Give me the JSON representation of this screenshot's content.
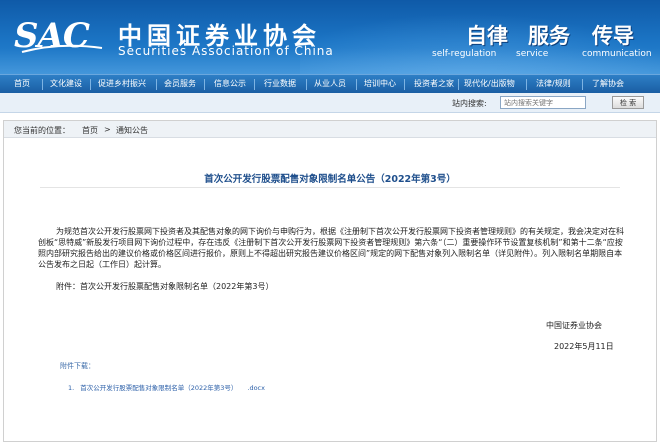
{
  "header": {
    "logo_text": "SAC",
    "org_name_cn": "中国证券业协会",
    "org_name_en": "Securities Association of China",
    "mottos": [
      {
        "cn": "自律",
        "en": "self-regulation"
      },
      {
        "cn": "服务",
        "en": "service"
      },
      {
        "cn": "传导",
        "en": "communication"
      }
    ]
  },
  "nav": {
    "items": [
      "首页",
      "文化建设",
      "促进乡村振兴",
      "会员服务",
      "信息公示",
      "行业数据",
      "从业人员",
      "培训中心",
      "投资者之家",
      "现代化/出版物",
      "法律/规则",
      "了解协会"
    ]
  },
  "search": {
    "label": "站内搜索:",
    "placeholder": "站内搜索关键字",
    "button": "检 索"
  },
  "breadcrumb": {
    "prefix": "您当前的位置：",
    "home": "首页",
    "sep": ">",
    "section": "通知公告"
  },
  "article": {
    "title": "首次公开发行股票配售对象限制名单公告（2022年第3号）",
    "body": "为规范首次公开发行股票网下投资者及其配售对象的网下询价与申购行为，根据《注册制下首次公开发行股票网下投资者管理规则》的有关规定，我会决定对在科创板“思特威”新股发行项目网下询价过程中，存在违反《注册制下首次公开发行股票网下投资者管理规则》第六条“（二）重要操作环节设置复核机制”和第十二条“应按照内部研究报告给出的建议价格或价格区间进行报价，原则上不得超出研究报告建议价格区间”规定的网下配售对象列入限制名单（详见附件）。列入限制名单期限自本公告发布之日起（工作日）起计算。",
    "attachment_line": "附件：首次公开发行股票配售对象限制名单（2022年第3号）",
    "signature_org": "中国证券业协会",
    "signature_date": "2022年5月11日"
  },
  "downloads": {
    "label": "附件下载：",
    "items": [
      {
        "num": "1.",
        "name": "首次公开发行股票配售对象限制名单（2022年第3号）",
        "ext": ".docx"
      }
    ]
  }
}
